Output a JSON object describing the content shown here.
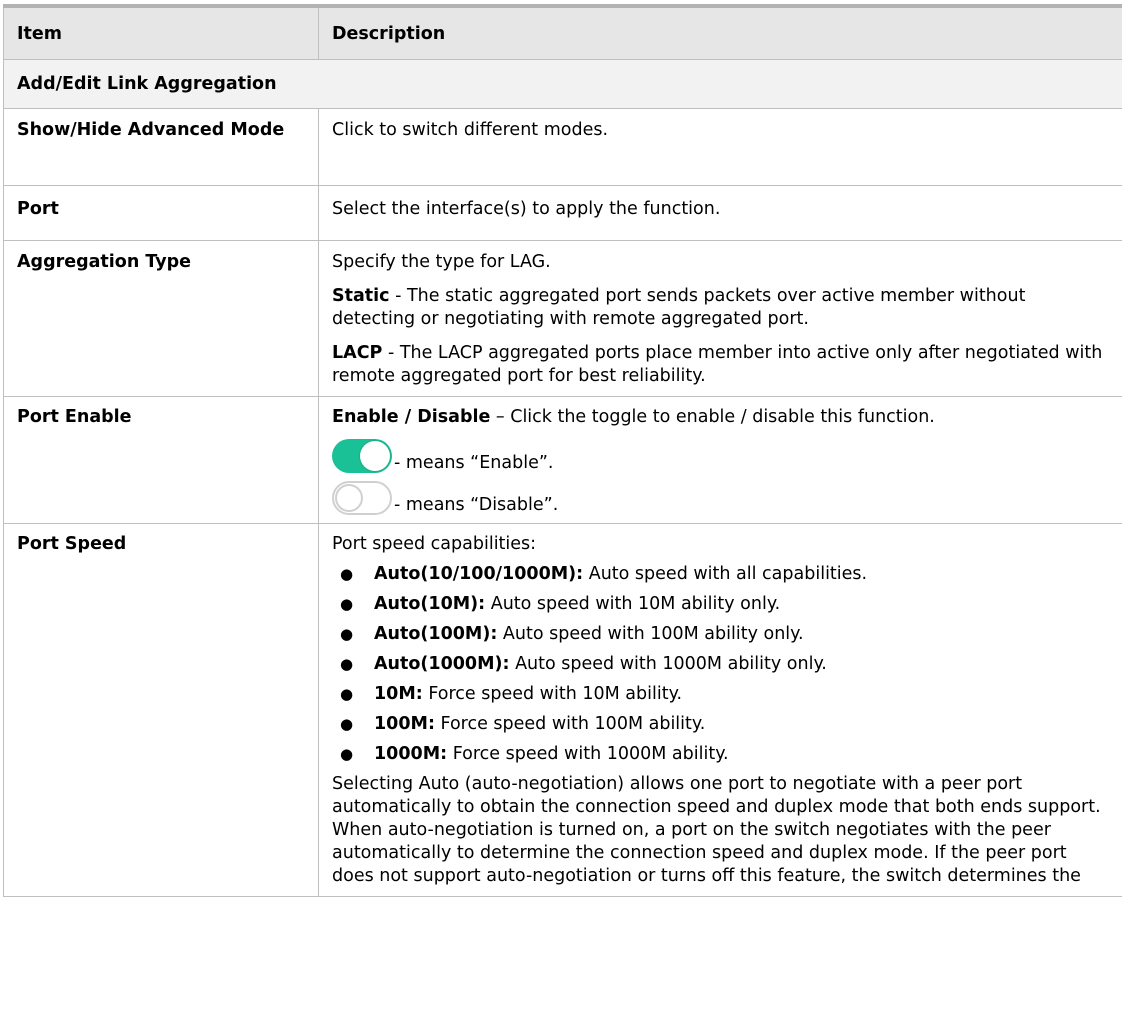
{
  "header": {
    "item": "Item",
    "description": "Description"
  },
  "section_title": "Add/Edit Link Aggregation",
  "rows": {
    "mode": {
      "item": "Show/Hide Advanced Mode",
      "desc": "Click to switch different modes."
    },
    "port": {
      "item": "Port",
      "desc": "Select the interface(s) to apply the function."
    },
    "aggregation": {
      "item": "Aggregation Type",
      "intro": "Specify the type for LAG.",
      "static_label": "Static",
      "static_text": " - The static aggregated port sends packets over active member without detecting or negotiating with remote aggregated port.",
      "lacp_label": "LACP",
      "lacp_text": " - The LACP aggregated ports place member into active only after negotiated with remote aggregated port for best reliability."
    },
    "port_enable": {
      "item": "Port Enable",
      "label": "Enable / Disable",
      "text": " – Click the toggle to enable / disable this function.",
      "enable_caption": "- means “Enable”.",
      "disable_caption": "- means “Disable”."
    },
    "port_speed": {
      "item": "Port Speed",
      "intro": "Port speed capabilities:",
      "bullet_glyph": "●",
      "options": [
        {
          "label": "Auto(10/100/1000M):",
          "text": " Auto speed with all capabilities."
        },
        {
          "label": "Auto(10M):",
          "text": " Auto speed with 10M ability only."
        },
        {
          "label": "Auto(100M):",
          "text": " Auto speed with 100M ability only."
        },
        {
          "label": "Auto(1000M):",
          "text": " Auto speed with 1000M ability only."
        },
        {
          "label": "10M:",
          "text": " Force speed with 10M ability."
        },
        {
          "label": "100M:",
          "text": " Force speed with 100M ability."
        },
        {
          "label": "1000M:",
          "text": " Force speed with 1000M ability."
        }
      ],
      "note": "Selecting Auto (auto-negotiation) allows one port to negotiate with a peer port automatically to obtain the connection speed and duplex mode that both ends support. When auto-negotiation is turned on, a port on the switch negotiates with the peer automatically to determine the connection speed and duplex mode. If the peer port does not support auto-negotiation or turns off this feature, the switch determines the"
    }
  },
  "colors": {
    "toggle_on": "#1bc196",
    "header_bg": "#e6e6e6",
    "section_bg": "#f2f2f2",
    "border": "#bfbfbf"
  },
  "icons": {
    "toggle_on": "toggle-on-icon",
    "toggle_off": "toggle-off-icon",
    "bullet": "bullet-dot-icon"
  }
}
